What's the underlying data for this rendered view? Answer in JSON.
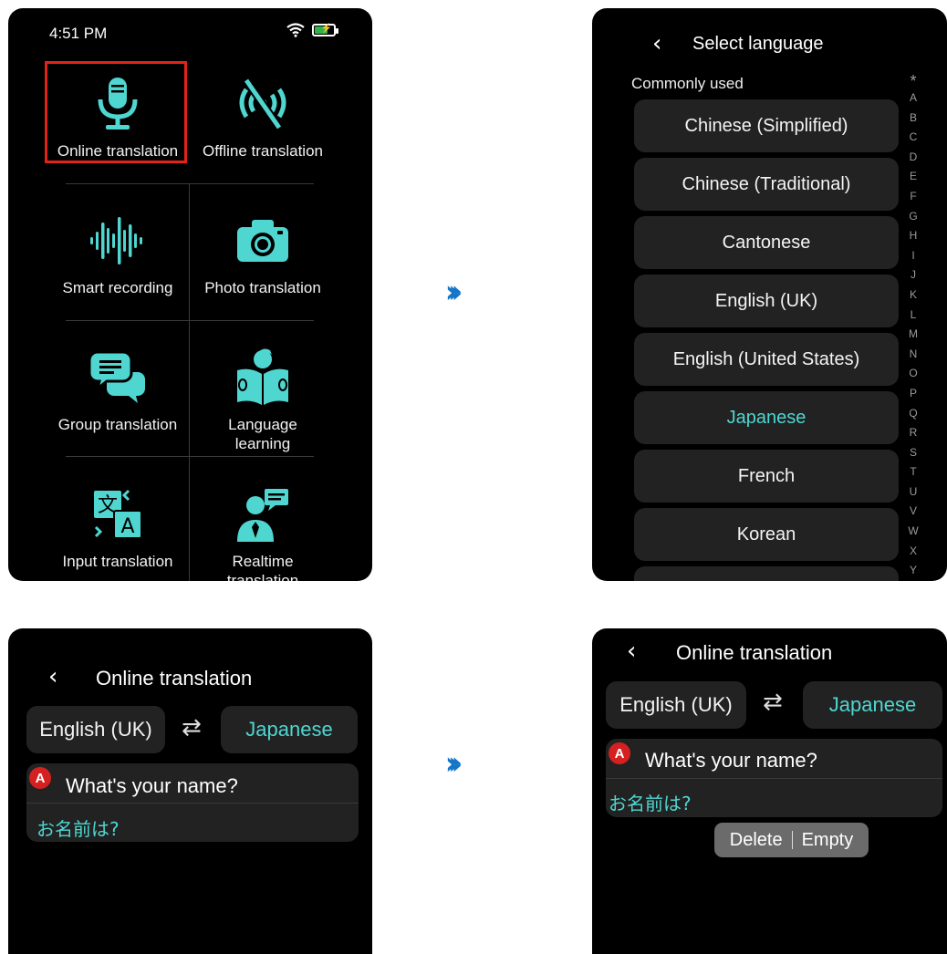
{
  "colors": {
    "accent": "#4fd6d0",
    "highlight": "#e2231a",
    "arrow": "#1576c8",
    "card": "#222222",
    "badge": "#d42020"
  },
  "arrows": {
    "glyph": "›››"
  },
  "home": {
    "time": "4:51 PM",
    "tiles": [
      {
        "label": "Online translation",
        "icon": "microphone-icon"
      },
      {
        "label": "Offline translation",
        "icon": "no-signal-icon"
      },
      {
        "label": "Smart recording",
        "icon": "soundwave-icon"
      },
      {
        "label": "Photo translation",
        "icon": "camera-icon"
      },
      {
        "label": "Group translation",
        "icon": "chat-bubbles-icon"
      },
      {
        "label": "Language learning",
        "icon": "reading-book-icon"
      },
      {
        "label": "Input translation",
        "icon": "translate-icon"
      },
      {
        "label": "Realtime translation",
        "icon": "presenter-icon"
      }
    ]
  },
  "select_language": {
    "title": "Select language",
    "section": "Commonly used",
    "languages": [
      "Chinese (Simplified)",
      "Chinese (Traditional)",
      "Cantonese",
      "English (UK)",
      "English (United States)",
      "Japanese",
      "French",
      "Korean"
    ],
    "selected": "Japanese",
    "index": [
      "*",
      "A",
      "B",
      "C",
      "D",
      "E",
      "F",
      "G",
      "H",
      "I",
      "J",
      "K",
      "L",
      "M",
      "N",
      "O",
      "P",
      "Q",
      "R",
      "S",
      "T",
      "U",
      "V",
      "W",
      "X",
      "Y"
    ]
  },
  "translation": {
    "title": "Online translation",
    "source_lang": "English (UK)",
    "target_lang": "Japanese",
    "swap_glyph": "⇄",
    "badge": "A",
    "question": "What's your name?",
    "answer": "お名前は?"
  },
  "context_menu": {
    "delete": "Delete",
    "empty": "Empty"
  }
}
